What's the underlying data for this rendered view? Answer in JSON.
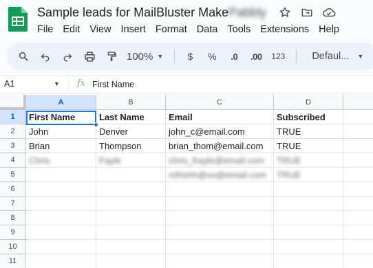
{
  "header": {
    "title": "Sample leads for MailBluster Make",
    "title_obscured": "Pabbly",
    "menu": [
      "File",
      "Edit",
      "View",
      "Insert",
      "Format",
      "Data",
      "Tools",
      "Extensions",
      "Help"
    ]
  },
  "toolbar": {
    "zoom": "100%",
    "currency": "$",
    "percent": "%",
    "decrease_decimal": ".0",
    "increase_decimal": ".00",
    "number_format": "123",
    "font": "Defaul..."
  },
  "formula_bar": {
    "cell_ref": "A1",
    "fx": "fx",
    "value": "First Name"
  },
  "grid": {
    "columns": [
      "A",
      "B",
      "C",
      "D"
    ],
    "rows": [
      "1",
      "2",
      "3",
      "4",
      "5",
      "6",
      "7",
      "8",
      "9",
      "10",
      "11"
    ],
    "cells": [
      [
        "First Name",
        "Last Name",
        "Email",
        "Subscribed"
      ],
      [
        "John",
        "Denver",
        "john_c@email.com",
        "TRUE"
      ],
      [
        "Brian",
        "Thompson",
        "brian_thom@email.com",
        "TRUE"
      ],
      [
        "Chris",
        "Fayle",
        "chris_frayle@email.com",
        "TRUE"
      ],
      [
        "",
        "",
        "mfrishh@xo@email.com",
        "TRUE"
      ]
    ],
    "blurred_rows": [
      3,
      4
    ]
  },
  "colors": {
    "accent": "#1a73e8",
    "sheets_green": "#0f9d58",
    "selected_header": "#d3e3fd"
  },
  "icons": {
    "title": [
      "star-icon",
      "move-to-folder-icon",
      "cloud-status-icon"
    ],
    "toolbar": [
      "search-icon",
      "undo-icon",
      "redo-icon",
      "print-icon",
      "paint-format-icon"
    ]
  }
}
